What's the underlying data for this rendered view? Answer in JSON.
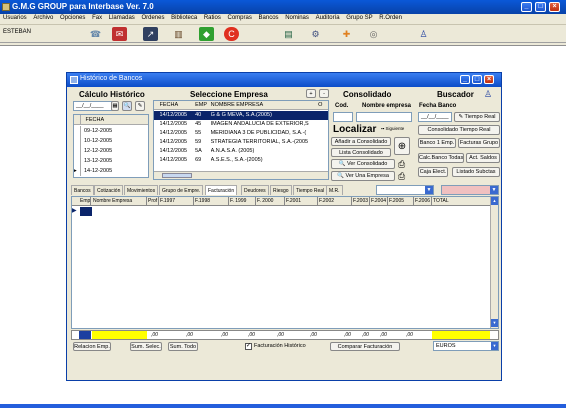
{
  "app": {
    "title": "G.M.G GROUP para Interbase Ver. 7.0"
  },
  "menu": [
    "Usuarios",
    "Archivo",
    "Opciones",
    "Fax",
    "Llamadas",
    "Ordenes",
    "Biblioteca",
    "Ratios",
    "Compras",
    "Bancos",
    "Nominas",
    "Auditoría",
    "Grupo SP",
    "R.Orden"
  ],
  "status": {
    "user": "ESTEBAN"
  },
  "window": {
    "title": "Histórico de Bancos"
  },
  "calc": {
    "heading": "Cálculo Histórico",
    "date_value": "__/__/____",
    "col_header": "FECHA",
    "dates": [
      "09-12-2005",
      "10-12-2005",
      "12-12-2005",
      "13-12-2005",
      "14-12-2005"
    ]
  },
  "empresa": {
    "heading": "Seleccione Empresa",
    "headers": {
      "fecha": "FECHA",
      "emp": "EMP",
      "nombre": "NOMBRE EMPRESA",
      "o": "O"
    },
    "rows": [
      {
        "fecha": "14/12/2005",
        "emp": "40",
        "nombre": "G & G MEVA, S.A.(2005)"
      },
      {
        "fecha": "14/12/2005",
        "emp": "45",
        "nombre": "IMAGEN ANDALUCIA DE EXTERIOR,S"
      },
      {
        "fecha": "14/12/2005",
        "emp": "55",
        "nombre": "MERIDIANA 3 DE PUBLICIDAD, S.A.-("
      },
      {
        "fecha": "14/12/2005",
        "emp": "59",
        "nombre": "STRATEGIA TERRITORIAL, S.A.-(2005"
      },
      {
        "fecha": "14/12/2005",
        "emp": "5A",
        "nombre": "A.N.A.S.A. (2005)"
      },
      {
        "fecha": "14/12/2005",
        "emp": "69",
        "nombre": "A.S.E.S., S.A.-(2005)"
      }
    ],
    "nav_plus": "+",
    "nav_minus": "-"
  },
  "consolidado": {
    "heading": "Consolidado",
    "cod_label": "Cod.",
    "nombre_label": "Nombre empresa",
    "localizar": "Localizar",
    "siguiente": "Siguiente",
    "anadir": "Añadir a Consolidado",
    "lista": "Lista Consolidado",
    "ver_consolidado": "Ver Consolidado",
    "ver_empresa": "Ver Una Empresa"
  },
  "buscador": {
    "heading": "Buscador",
    "fecha_banco": "Fecha Banco",
    "date_value": "__/__/____",
    "tiempo_real": "Tiempo Real",
    "consolidado_tr": "Consolidado Tiempo Real",
    "banco1": "Banco 1 Emp.",
    "facturas": "Facturas Grupo",
    "calc_banco": "Calc.Banco Todas",
    "act_saldos": "Act. Saldos",
    "caja_elect": "Caja Elect.",
    "listado": "Listado Subctas"
  },
  "tabs": [
    "Bancos",
    "Cotización",
    "Movimientos",
    "Grupo de Empre.",
    "Facturación",
    "Deudores",
    "Riesgo",
    "Tiempo Real",
    "M.R."
  ],
  "active_tab": "Facturación",
  "grid": {
    "headers": [
      "Emp.",
      "Nombre Empresa",
      "Prof",
      "F.1997",
      "F.1998",
      "F. 1999",
      "F. 2000",
      "F.2001",
      "F.2002",
      "F.2003",
      "F.2004",
      "F.2005",
      "F.2006",
      "TOTAL"
    ],
    "totals": [
      ",00",
      ",00",
      ",00",
      ",00",
      ",00",
      ",00",
      ",00",
      ",00",
      ",00",
      ",00"
    ]
  },
  "bottom": {
    "relacion": "Relacion Emp.",
    "sum_selec": "Sum. Selec.",
    "sum_todo": "Sum. Todo",
    "fact_hist": "Facturación Histórico",
    "fact_hist_checked": true,
    "comparar": "Comparar Facturación",
    "currency": "EUROS"
  },
  "colors": {
    "titlebar": "#0842a8",
    "selection": "#0a246a",
    "yellow": "#ffff00",
    "pink": "#f0c0c0",
    "cream": "#ffffe0"
  }
}
